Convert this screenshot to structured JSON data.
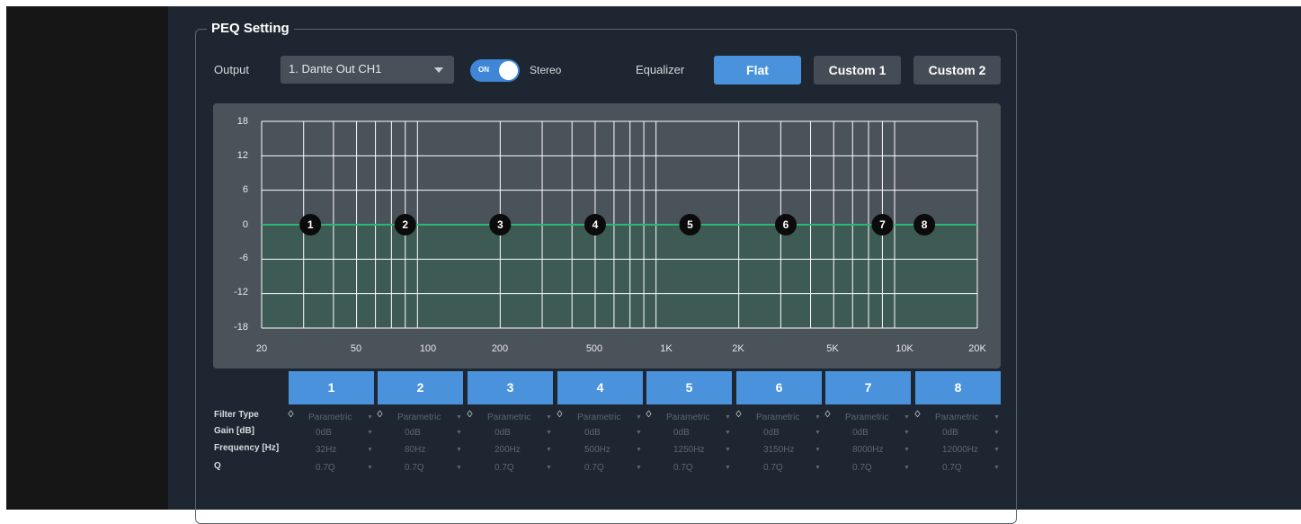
{
  "section": {
    "title": "PEQ Setting"
  },
  "output": {
    "label": "Output",
    "selected": "1. Dante Out CH1"
  },
  "stereo": {
    "toggle_text": "ON",
    "label": "Stereo",
    "enabled": true
  },
  "equalizer": {
    "label": "Equalizer",
    "presets": [
      "Flat",
      "Custom 1",
      "Custom 2"
    ],
    "active_preset": "Flat"
  },
  "graph": {
    "y_ticks": [
      "18",
      "12",
      "6",
      "0",
      "-6",
      "-12",
      "-18"
    ],
    "x_ticks": [
      "20",
      "50",
      "100",
      "200",
      "500",
      "1K",
      "2K",
      "5K",
      "10K",
      "20K"
    ],
    "curve_gain_db": 0,
    "colors": {
      "curve": "#2bb673",
      "fill": "#3d5a55",
      "grid": "#ffffff",
      "node": "#0b0b0b"
    }
  },
  "bands": {
    "labels": [
      "1",
      "2",
      "3",
      "4",
      "5",
      "6",
      "7",
      "8"
    ],
    "filter_type": [
      "Parametric",
      "Parametric",
      "Parametric",
      "Parametric",
      "Parametric",
      "Parametric",
      "Parametric",
      "Parametric"
    ],
    "gain": [
      "0dB",
      "0dB",
      "0dB",
      "0dB",
      "0dB",
      "0dB",
      "0dB",
      "0dB"
    ],
    "frequency": [
      "32Hz",
      "80Hz",
      "200Hz",
      "500Hz",
      "1250Hz",
      "3150Hz",
      "8000Hz",
      "12000Hz"
    ],
    "q": [
      "0.7Q",
      "0.7Q",
      "0.7Q",
      "0.7Q",
      "0.7Q",
      "0.7Q",
      "0.7Q",
      "0.7Q"
    ],
    "frequency_values_hz": [
      32,
      80,
      200,
      500,
      1250,
      3150,
      8000,
      12000
    ]
  },
  "row_labels": {
    "filter_type": "Filter Type",
    "gain": "Gain [dB]",
    "frequency": "Frequency [Hz]",
    "q": "Q"
  },
  "accent_color": "#4a93dc"
}
